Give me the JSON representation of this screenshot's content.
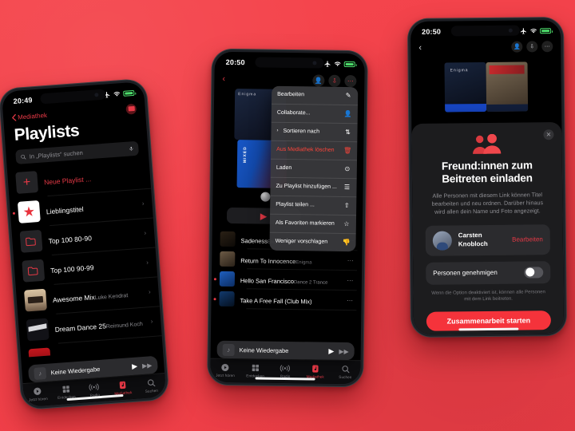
{
  "background_color": "#f4434b",
  "accent_color": "#e63946",
  "phone1": {
    "status": {
      "clock": "20:49",
      "airplane_icon": "airplane-icon",
      "wifi_icon": "wifi-icon",
      "battery_icon": "battery-icon"
    },
    "nav": {
      "back_label": "Mediathek",
      "back_icon": "chevron-left-icon",
      "avatar_icon": "account-icon"
    },
    "title": "Playlists",
    "search": {
      "placeholder": "In „Playlists“ suchen",
      "icon": "search-icon",
      "mic_icon": "microphone-icon"
    },
    "rows": [
      {
        "name": "Neue Playlist ...",
        "sub": "",
        "art": "plus-icon",
        "accent": true,
        "chevron": false,
        "dot": false
      },
      {
        "name": "Lieblingstitel",
        "sub": "",
        "art": "star-icon",
        "accent": false,
        "chevron": true,
        "dot": true
      },
      {
        "name": "Top 100 80-90",
        "sub": "",
        "art": "folder-icon",
        "accent": false,
        "chevron": true,
        "dot": false
      },
      {
        "name": "Top 100 90-99",
        "sub": "",
        "art": "folder-icon",
        "accent": false,
        "chevron": true,
        "dot": false
      },
      {
        "name": "Awesome Mix",
        "sub": "Luke Kendrat",
        "art": "cassette-cover",
        "accent": false,
        "chevron": true,
        "dot": false
      },
      {
        "name": "Dream Dance 25",
        "sub": "Reimund Koch",
        "art": "dreamdance-cover",
        "accent": false,
        "chevron": true,
        "dot": false
      },
      {
        "name": "",
        "sub": "",
        "art": "red-cover",
        "accent": false,
        "chevron": false,
        "dot": false
      }
    ],
    "miniplayer": {
      "title": "Keine Wiedergabe",
      "play_icon": "play-icon",
      "next_icon": "forward-icon",
      "art_icon": "music-note-icon"
    },
    "tabs": [
      {
        "label": "Jetzt hören",
        "icon": "play-circle-icon",
        "active": false
      },
      {
        "label": "Entdecken",
        "icon": "grid-icon",
        "active": false
      },
      {
        "label": "Radio",
        "icon": "radio-icon",
        "active": false
      },
      {
        "label": "Mediathek",
        "icon": "library-icon",
        "active": true
      },
      {
        "label": "Suchen",
        "icon": "search-icon",
        "active": false
      }
    ]
  },
  "phone2": {
    "status": {
      "clock": "20:50"
    },
    "nav": {
      "back_icon": "chevron-left-icon",
      "actions": [
        {
          "icon": "add-person-icon"
        },
        {
          "icon": "download-icon"
        },
        {
          "icon": "more-icon"
        }
      ]
    },
    "album_label": "Enigma",
    "blue_cover_label": "MIXED",
    "play_icon": "play-icon",
    "context_menu": [
      {
        "label": "Bearbeiten",
        "icon": "pencil-icon",
        "danger": false,
        "caret": false
      },
      {
        "label": "Collaborate...",
        "icon": "person-add-icon",
        "danger": false,
        "caret": false
      },
      {
        "label": "Sortieren nach",
        "icon": "sort-icon",
        "danger": false,
        "caret": true
      },
      {
        "label": "Aus Mediathek löschen",
        "icon": "trash-icon",
        "danger": true,
        "caret": false
      },
      {
        "label": "Laden",
        "icon": "download-circle-icon",
        "danger": false,
        "caret": false
      },
      {
        "label": "Zu Playlist hinzufügen ...",
        "icon": "playlist-add-icon",
        "danger": false,
        "caret": false
      },
      {
        "label": "Playlist teilen ...",
        "icon": "share-icon",
        "danger": false,
        "caret": false
      },
      {
        "label": "Als Favoriten markieren",
        "icon": "star-outline-icon",
        "danger": false,
        "caret": false
      },
      {
        "label": "Weniger vorschlagen",
        "icon": "thumbs-down-icon",
        "danger": false,
        "caret": false
      }
    ],
    "songs": [
      {
        "name": "Sadeness",
        "sub": "Enigma",
        "dot": false,
        "art": "sart-1"
      },
      {
        "name": "Return To Innocence",
        "sub": "Enigma",
        "dot": false,
        "art": "sart-2"
      },
      {
        "name": "Hello San Francisco",
        "sub": "Dance 2 Trance",
        "dot": true,
        "art": "sart-3"
      },
      {
        "name": "Take A Free Fall (Club Mix)",
        "sub": "",
        "dot": true,
        "art": "sart-4"
      }
    ],
    "miniplayer": {
      "title": "Keine Wiedergabe",
      "play_icon": "play-icon",
      "next_icon": "forward-icon",
      "art_icon": "music-note-icon"
    },
    "tabs": [
      {
        "label": "Jetzt hören",
        "icon": "play-circle-icon",
        "active": false
      },
      {
        "label": "Entdecken",
        "icon": "grid-icon",
        "active": false
      },
      {
        "label": "Radio",
        "icon": "radio-icon",
        "active": false
      },
      {
        "label": "Mediathek",
        "icon": "library-icon",
        "active": true
      },
      {
        "label": "Suchen",
        "icon": "search-icon",
        "active": false
      }
    ]
  },
  "phone3": {
    "status": {
      "clock": "20:50"
    },
    "nav": {
      "back_icon": "chevron-left-icon",
      "actions": [
        {
          "icon": "add-person-icon"
        },
        {
          "icon": "download-icon"
        },
        {
          "icon": "more-icon"
        }
      ]
    },
    "cover_a_label": "Enigma",
    "sheet": {
      "close_icon": "close-icon",
      "hero_icon": "two-people-icon",
      "title": "Freund:innen zum Beitreten einladen",
      "description": "Alle Personen mit diesem Link können Titel bearbeiten und neu ordnen. Darüber hinaus wird allen dein Name und Foto angezeigt.",
      "person": {
        "name": "Carsten Knobloch",
        "action": "Bearbeiten",
        "avatar_icon": "avatar"
      },
      "toggle": {
        "label": "Personen genehmigen",
        "state": "off"
      },
      "hint": "Wenn die Option deaktiviert ist, können alle Personen mit dem Link beitreten.",
      "cta": "Zusammenarbeit starten"
    }
  }
}
